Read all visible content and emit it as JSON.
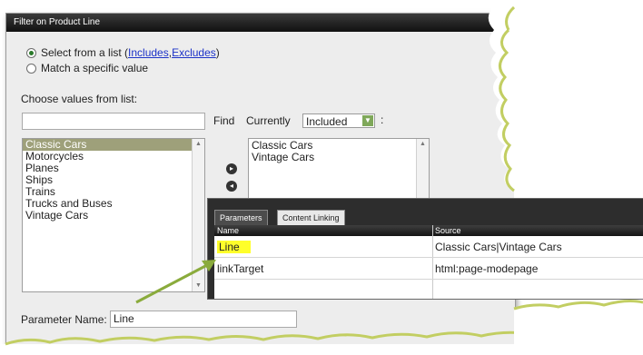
{
  "dialog": {
    "title": "Filter on Product Line",
    "radio_list": {
      "text": "Select from a list (",
      "includes": "Includes",
      "sep": ", ",
      "excludes": "Excludes",
      "close": ")"
    },
    "radio_match": "Match a specific value",
    "choose_label": "Choose values from list:",
    "find_label": "Find",
    "currently_label": "Currently",
    "currently_value": "Included",
    "colon": ":",
    "available_items": [
      "Classic Cars",
      "Motorcycles",
      "Planes",
      "Ships",
      "Trains",
      "Trucks and Buses",
      "Vintage Cars"
    ],
    "selected_items": [
      "Classic Cars",
      "Vintage Cars"
    ],
    "param_name_label": "Parameter Name:",
    "param_name_value": "Line"
  },
  "panel": {
    "tabs": [
      "Parameters",
      "Content Linking"
    ],
    "columns": [
      "Name",
      "Source"
    ],
    "rows": [
      {
        "name": "Line",
        "source": "Classic Cars|Vintage Cars"
      },
      {
        "name": "linkTarget",
        "source": "html:page-modepage"
      }
    ]
  },
  "colors": {
    "highlight": "#ffff2a",
    "arrow": "#8aab3c",
    "selected_row": "#9ea07a",
    "title_bar": "#1e1e1e"
  }
}
